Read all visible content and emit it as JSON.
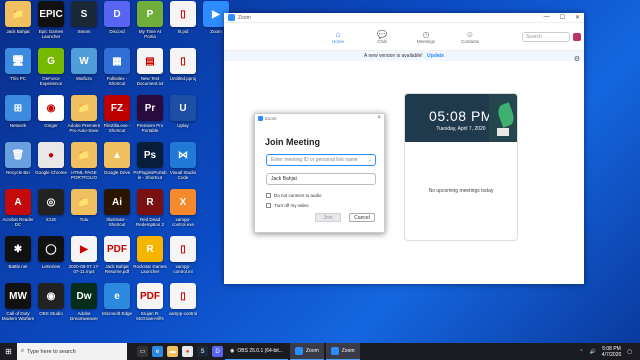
{
  "desktop_icons": [
    {
      "label": "Jack Bahjat",
      "color": "#f0c060",
      "glyph": "📁",
      "col": 0,
      "row": 0
    },
    {
      "label": "Epic Games Launcher",
      "color": "#111111",
      "glyph": "EPIC",
      "col": 1,
      "row": 0
    },
    {
      "label": "Steam",
      "color": "#1b2838",
      "glyph": "S",
      "col": 2,
      "row": 0
    },
    {
      "label": "Discord",
      "color": "#5865f2",
      "glyph": "D",
      "col": 3,
      "row": 0
    },
    {
      "label": "My Time At Portia",
      "color": "#6fae3a",
      "glyph": "P",
      "col": 4,
      "row": 0
    },
    {
      "label": "hl.pid",
      "color": "#f5f5f5",
      "glyph": "▯",
      "col": 5,
      "row": 0
    },
    {
      "label": "Zoom",
      "color": "#2d8cff",
      "glyph": "▶",
      "col": 6,
      "row": 0
    },
    {
      "label": "This PC",
      "color": "#3b8be0",
      "glyph": "🖥",
      "col": 0,
      "row": 1
    },
    {
      "label": "GeForce Experience",
      "color": "#76b900",
      "glyph": "G",
      "col": 1,
      "row": 1
    },
    {
      "label": "Waifu2x",
      "color": "#4f9edb",
      "glyph": "W",
      "col": 2,
      "row": 1
    },
    {
      "label": "Fullvalex - Shortcut",
      "color": "#2f6fd6",
      "glyph": "▦",
      "col": 3,
      "row": 1
    },
    {
      "label": "New Text Document.txt",
      "color": "#f5f5f5",
      "glyph": "▤",
      "col": 4,
      "row": 1
    },
    {
      "label": "Untitled.pproj",
      "color": "#f5f5f5",
      "glyph": "▯",
      "col": 5,
      "row": 1
    },
    {
      "label": "Network",
      "color": "#3b8be0",
      "glyph": "⊞",
      "col": 0,
      "row": 2
    },
    {
      "label": "Ginger",
      "color": "#ffffff",
      "glyph": "◉",
      "col": 1,
      "row": 2
    },
    {
      "label": "Adobe Premiere Pro Auto-Save",
      "color": "#f0c060",
      "glyph": "📁",
      "col": 2,
      "row": 2
    },
    {
      "label": "FileZilla.exe - Shortcut",
      "color": "#bf0000",
      "glyph": "FZ",
      "col": 3,
      "row": 2
    },
    {
      "label": "Premiere Pro Portable",
      "color": "#2a0b3d",
      "glyph": "Pr",
      "col": 4,
      "row": 2
    },
    {
      "label": "Uplay",
      "color": "#1d4fa5",
      "glyph": "U",
      "col": 5,
      "row": 2
    },
    {
      "label": "Recycle Bin",
      "color": "#6aa0e0",
      "glyph": "🗑",
      "col": 0,
      "row": 3
    },
    {
      "label": "Google Chrome",
      "color": "#e8e8e8",
      "glyph": "●",
      "col": 1,
      "row": 3
    },
    {
      "label": "HTML PAGE PORTFOLIO",
      "color": "#f0c060",
      "glyph": "📁",
      "col": 2,
      "row": 3
    },
    {
      "label": "Google Drive",
      "color": "#f0c060",
      "glyph": "▲",
      "col": 3,
      "row": 3
    },
    {
      "label": "PsPluginsPortable - Shortcut",
      "color": "#061e3a",
      "glyph": "Ps",
      "col": 4,
      "row": 3
    },
    {
      "label": "Visual Studio Code",
      "color": "#1f7bd6",
      "glyph": "⋈",
      "col": 5,
      "row": 3
    },
    {
      "label": "Acrobat Reader DC",
      "color": "#c40a0a",
      "glyph": "A",
      "col": 0,
      "row": 4
    },
    {
      "label": "iCUE",
      "color": "#222222",
      "glyph": "◎",
      "col": 1,
      "row": 4
    },
    {
      "label": "Tutu",
      "color": "#f0c060",
      "glyph": "📁",
      "col": 2,
      "row": 4
    },
    {
      "label": "Illustrator - Shortcut",
      "color": "#2b1500",
      "glyph": "Ai",
      "col": 3,
      "row": 4
    },
    {
      "label": "Red Dead Redemption 2",
      "color": "#7a1010",
      "glyph": "R",
      "col": 4,
      "row": 4
    },
    {
      "label": "xampp-control.exe",
      "color": "#f48a2c",
      "glyph": "X",
      "col": 5,
      "row": 4
    },
    {
      "label": "Battle.net",
      "color": "#111111",
      "glyph": "✱",
      "col": 0,
      "row": 5
    },
    {
      "label": "LetsView",
      "color": "#111111",
      "glyph": "◯",
      "col": 1,
      "row": 5
    },
    {
      "label": "2020-08-07 17-07-11.mp4",
      "color": "#f5f5f5",
      "glyph": "▶",
      "col": 2,
      "row": 5
    },
    {
      "label": "Jack Bahjat Resume.pdf",
      "color": "#f5f5f5",
      "glyph": "PDF",
      "col": 3,
      "row": 5
    },
    {
      "label": "Rockstar Games Launcher",
      "color": "#f5b400",
      "glyph": "R",
      "col": 4,
      "row": 5
    },
    {
      "label": "xampp-control.ini",
      "color": "#f5f5f5",
      "glyph": "▯",
      "col": 5,
      "row": 5
    },
    {
      "label": "Call of Duty Modern Warfare",
      "color": "#111111",
      "glyph": "MW",
      "col": 0,
      "row": 6
    },
    {
      "label": "OBS Studio",
      "color": "#222222",
      "glyph": "◉",
      "col": 1,
      "row": 6
    },
    {
      "label": "Adobe Dreamweaver",
      "color": "#062e1a",
      "glyph": "Dw",
      "col": 2,
      "row": 6
    },
    {
      "label": "Microsoft Edge",
      "color": "#2b8ae0",
      "glyph": "e",
      "col": 3,
      "row": 6
    },
    {
      "label": "Srujan R. McGraw-Hill's",
      "color": "#f5f5f5",
      "glyph": "PDF",
      "col": 4,
      "row": 6
    },
    {
      "label": "xampp-control",
      "color": "#f5f5f5",
      "glyph": "▯",
      "col": 5,
      "row": 6
    }
  ],
  "zoom_window": {
    "title": "Zoom",
    "controls": [
      "—",
      "☐",
      "✕"
    ],
    "nav": [
      {
        "label": "Home",
        "icon": "⌂",
        "active": true
      },
      {
        "label": "Chat",
        "icon": "💬",
        "active": false
      },
      {
        "label": "Meetings",
        "icon": "◷",
        "active": false
      },
      {
        "label": "Contacts",
        "icon": "☺",
        "active": false
      }
    ],
    "search_placeholder": "Search",
    "banner_text": "A new version is available!",
    "banner_link": "Update",
    "clock_time": "05:08 PM",
    "clock_date": "Tuesday, April 7, 2020",
    "no_meetings": "No upcoming meetings today"
  },
  "join_dialog": {
    "window_title": "Zoom",
    "heading": "Join Meeting",
    "meeting_id_placeholder": "Enter meeting ID or personal link name",
    "name_value": "Jack Bahjat",
    "opt_audio": "Do not connect to audio",
    "opt_video": "Turn off my video",
    "join_label": "Join",
    "cancel_label": "Cancel"
  },
  "taskbar": {
    "search_placeholder": "Type here to search",
    "apps": [
      {
        "label": "OBS 25.0.1 (64-bit..."
      },
      {
        "label": "Zoom"
      },
      {
        "label": "Zoom"
      }
    ],
    "time": "5:08 PM",
    "date": "4/7/2020"
  },
  "colors": {
    "accent": "#2d8cff"
  }
}
